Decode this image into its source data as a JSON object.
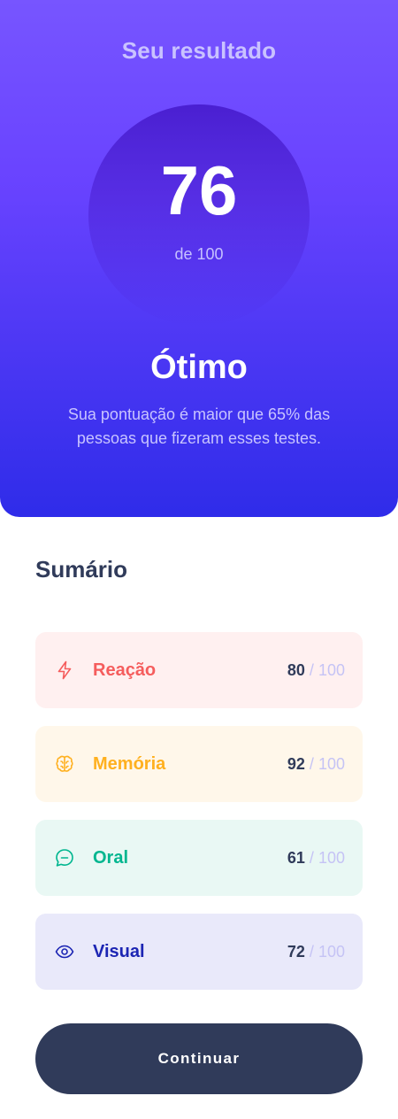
{
  "result": {
    "heading": "Seu resultado",
    "score": "76",
    "score_max": "de 100",
    "rating": "Ótimo",
    "description": "Sua pontuação é maior que 65% das pessoas que fizeram esses testes."
  },
  "summary": {
    "title": "Sumário",
    "separator": "/",
    "items": [
      {
        "label": "Reação",
        "score": "80",
        "max": "100",
        "icon": "lightning-icon",
        "color": "#f55d5d",
        "background": "#fff0f0"
      },
      {
        "label": "Memória",
        "score": "92",
        "max": "100",
        "icon": "brain-icon",
        "color": "#ffb01f",
        "background": "#fff7ea"
      },
      {
        "label": "Oral",
        "score": "61",
        "max": "100",
        "icon": "chat-bubble-icon",
        "color": "#00b68f",
        "background": "#e9f8f4"
      },
      {
        "label": "Visual",
        "score": "72",
        "max": "100",
        "icon": "eye-icon",
        "color": "#1c25b3",
        "background": "#e9e9fa"
      }
    ]
  },
  "actions": {
    "continue_label": "Continuar"
  },
  "colors": {
    "gradient_top": "#7755ff",
    "gradient_bottom": "#2f2ce9",
    "dark_navy": "#303b5a",
    "white": "#ffffff"
  }
}
